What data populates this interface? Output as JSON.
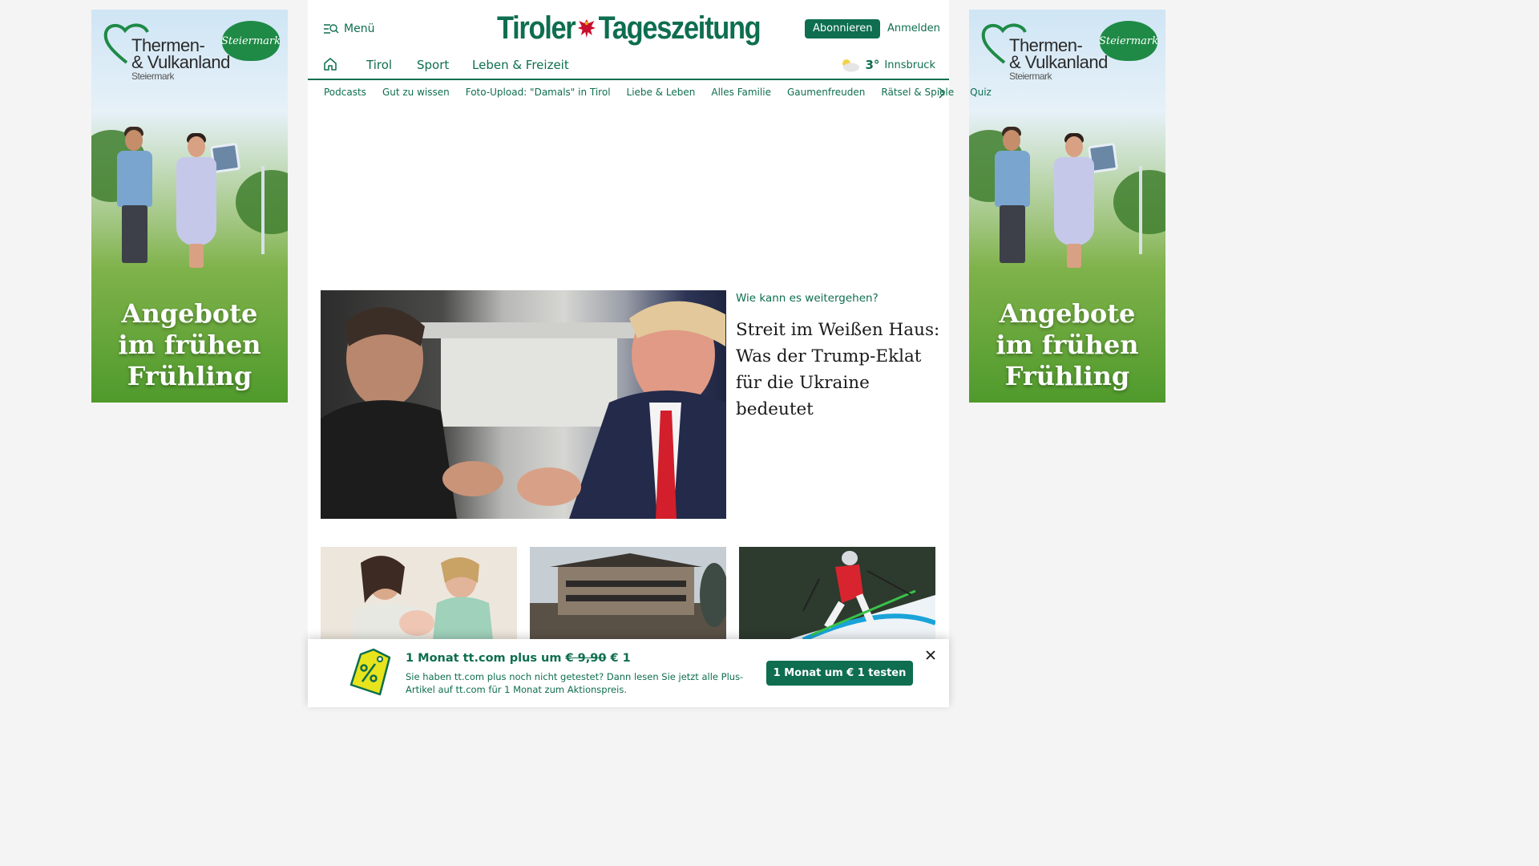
{
  "ads": {
    "brand_line1": "Thermen-",
    "brand_line2": "& Vulkanland",
    "brand_sub": "Steiermark",
    "badge": "Steiermark",
    "slogan_line1": "Angebote",
    "slogan_line2": "im frühen",
    "slogan_line3": "Frühling"
  },
  "header": {
    "menu_label": "Menü",
    "logo_left": "Tiroler",
    "logo_right": "Tageszeitung",
    "subscribe_label": "Abonnieren",
    "login_label": "Anmelden"
  },
  "nav": {
    "items": [
      "Tirol",
      "Sport",
      "Leben & Freizeit"
    ],
    "weather_temp": "3°",
    "weather_city": "Innsbruck"
  },
  "subnav": {
    "items": [
      "Podcasts",
      "Gut zu wissen",
      "Foto-Upload: \"Damals\" in Tirol",
      "Liebe & Leben",
      "Alles Familie",
      "Gaumenfreuden",
      "Rätsel & Spiele",
      "Quiz"
    ]
  },
  "hero": {
    "kicker": "Wie kann es weitergehen?",
    "headline": "Streit im Weißen Haus: Was der Trump-Eklat für die Ukraine bedeutet"
  },
  "promo": {
    "title_prefix": "1 Monat tt.com plus um",
    "old_price": "€ 9,90",
    "new_price": "€ 1",
    "text": "Sie haben tt.com plus noch nicht getestet? Dann lesen Sie jetzt alle Plus-Artikel auf tt.com für 1 Monat zum Aktionspreis.",
    "button_label": "1 Monat um € 1 testen"
  },
  "colors": {
    "brand_green": "#0e6e4f",
    "promo_tag": "#e7e31c"
  }
}
